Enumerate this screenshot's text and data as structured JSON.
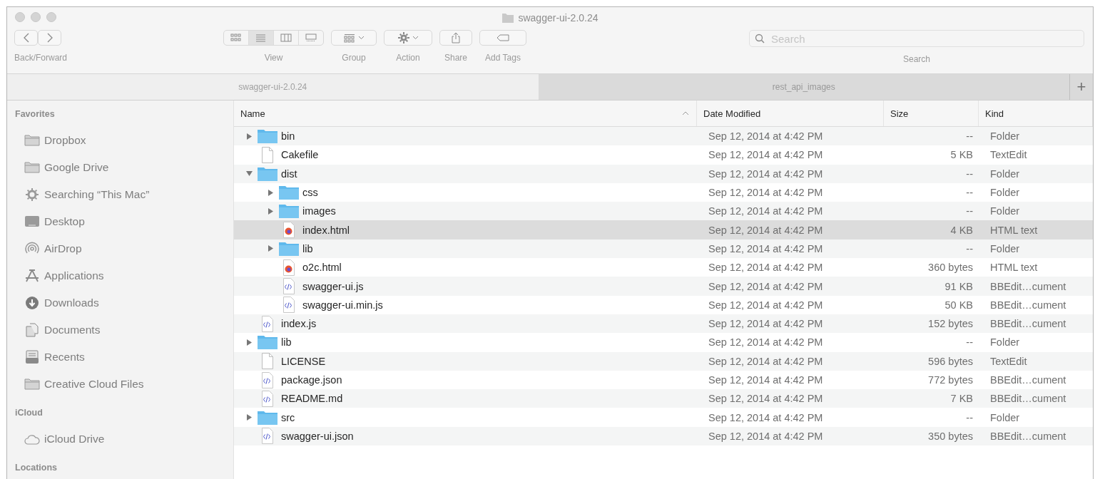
{
  "window": {
    "title": "swagger-ui-2.0.24"
  },
  "toolbar": [
    {
      "kind": "nav",
      "label": "Back/Forward"
    },
    {
      "kind": "view",
      "label": "View",
      "segments": [
        {
          "selected": false
        },
        {
          "selected": true
        },
        {
          "selected": false
        },
        {
          "selected": false
        }
      ]
    },
    {
      "kind": "group",
      "label": "Group"
    },
    {
      "kind": "action",
      "label": "Action"
    },
    {
      "kind": "share",
      "label": "Share"
    },
    {
      "kind": "tags",
      "label": "Add Tags"
    }
  ],
  "search": {
    "placeholder": "Search",
    "label": "Search"
  },
  "tabs": [
    {
      "label": "swagger-ui-2.0.24",
      "selected": true
    },
    {
      "label": "rest_api_images",
      "selected": false
    }
  ],
  "new_tab": "+",
  "sidebar": [
    {
      "title": "Favorites",
      "items": [
        {
          "label": "Dropbox"
        },
        {
          "label": "Google Drive"
        },
        {
          "label": "Searching “This Mac”"
        },
        {
          "label": "Desktop"
        },
        {
          "label": "AirDrop"
        },
        {
          "label": "Applications"
        },
        {
          "label": "Downloads"
        },
        {
          "label": "Documents"
        },
        {
          "label": "Recents"
        },
        {
          "label": "Creative Cloud Files"
        }
      ]
    },
    {
      "title": "iCloud",
      "items": [
        {
          "label": "iCloud Drive"
        }
      ]
    },
    {
      "title": "Locations"
    }
  ],
  "columns": [
    {
      "label": "Name",
      "sorted": true
    },
    {
      "label": "Date Modified",
      "sorted": false
    },
    {
      "label": "Size",
      "sorted": false
    },
    {
      "label": "Kind",
      "sorted": false
    }
  ],
  "rows": [
    {
      "kind": "folder",
      "name": "bin",
      "date": "Sep 12, 2014 at 4:42 PM",
      "size": "--",
      "type": "Folder",
      "expanded": false,
      "selected": false
    },
    {
      "kind": "document",
      "name": "Cakefile",
      "date": "Sep 12, 2014 at 4:42 PM",
      "size": "5 KB",
      "type": "TextEdit",
      "selected": false
    },
    {
      "kind": "folder",
      "name": "dist",
      "date": "Sep 12, 2014 at 4:42 PM",
      "size": "--",
      "type": "Folder",
      "expanded": true,
      "selected": false,
      "children": [
        {
          "kind": "folder",
          "name": "css",
          "date": "Sep 12, 2014 at 4:42 PM",
          "size": "--",
          "type": "Folder",
          "expanded": false,
          "selected": false
        },
        {
          "kind": "folder",
          "name": "images",
          "date": "Sep 12, 2014 at 4:42 PM",
          "size": "--",
          "type": "Folder",
          "expanded": false,
          "selected": false
        },
        {
          "kind": "html",
          "name": "index.html",
          "date": "Sep 12, 2014 at 4:42 PM",
          "size": "4 KB",
          "type": "HTML text",
          "selected": true
        },
        {
          "kind": "folder",
          "name": "lib",
          "date": "Sep 12, 2014 at 4:42 PM",
          "size": "--",
          "type": "Folder",
          "expanded": false,
          "selected": false
        },
        {
          "kind": "html",
          "name": "o2c.html",
          "date": "Sep 12, 2014 at 4:42 PM",
          "size": "360 bytes",
          "type": "HTML text",
          "selected": false
        },
        {
          "kind": "script",
          "name": "swagger-ui.js",
          "date": "Sep 12, 2014 at 4:42 PM",
          "size": "91 KB",
          "type": "BBEdit…cument",
          "selected": false
        },
        {
          "kind": "script",
          "name": "swagger-ui.min.js",
          "date": "Sep 12, 2014 at 4:42 PM",
          "size": "50 KB",
          "type": "BBEdit…cument",
          "selected": false
        }
      ]
    },
    {
      "kind": "script",
      "name": "index.js",
      "date": "Sep 12, 2014 at 4:42 PM",
      "size": "152 bytes",
      "type": "BBEdit…cument",
      "selected": false
    },
    {
      "kind": "folder",
      "name": "lib",
      "date": "Sep 12, 2014 at 4:42 PM",
      "size": "--",
      "type": "Folder",
      "expanded": false,
      "selected": false
    },
    {
      "kind": "document",
      "name": "LICENSE",
      "date": "Sep 12, 2014 at 4:42 PM",
      "size": "596 bytes",
      "type": "TextEdit",
      "selected": false
    },
    {
      "kind": "script",
      "name": "package.json",
      "date": "Sep 12, 2014 at 4:42 PM",
      "size": "772 bytes",
      "type": "BBEdit…cument",
      "selected": false
    },
    {
      "kind": "script",
      "name": "README.md",
      "date": "Sep 12, 2014 at 4:42 PM",
      "size": "7 KB",
      "type": "BBEdit…cument",
      "selected": false
    },
    {
      "kind": "folder",
      "name": "src",
      "date": "Sep 12, 2014 at 4:42 PM",
      "size": "--",
      "type": "Folder",
      "expanded": false,
      "selected": false
    },
    {
      "kind": "script",
      "name": "swagger-ui.json",
      "date": "Sep 12, 2014 at 4:42 PM",
      "size": "350 bytes",
      "type": "BBEdit…cument",
      "selected": false
    }
  ]
}
